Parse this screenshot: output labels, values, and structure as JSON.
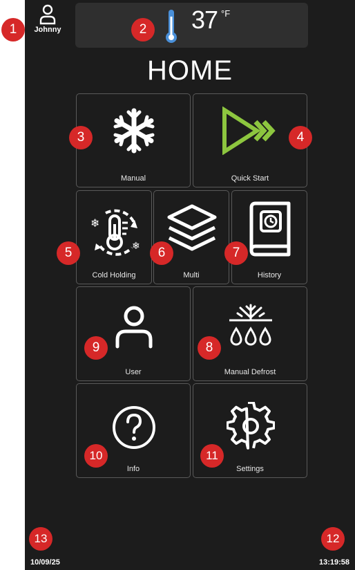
{
  "header": {
    "user_name": "Johnny",
    "temperature": "37",
    "temperature_unit": "°F"
  },
  "page_title": "HOME",
  "tiles": {
    "manual": "Manual",
    "quick_start": "Quick Start",
    "cold_holding": "Cold Holding",
    "multi": "Multi",
    "history": "History",
    "user": "User",
    "manual_defrost": "Manual Defrost",
    "info": "Info",
    "settings": "Settings"
  },
  "footer": {
    "date": "10/09/25",
    "time": "13:19:58"
  },
  "callouts": [
    "1",
    "2",
    "3",
    "4",
    "5",
    "6",
    "7",
    "8",
    "9",
    "10",
    "11",
    "12",
    "13"
  ],
  "colors": {
    "screen_bg": "#1c1c1c",
    "accent_green": "#8dc63f",
    "thermometer_blue": "#4a90d9",
    "callout_red": "#d62828"
  },
  "icons": {
    "user": "person-icon",
    "thermometer": "thermometer-icon",
    "manual": "snowflake-icon",
    "quick_start": "fast-forward-icon",
    "cold_holding": "thermometer-cycle-icon",
    "multi": "layers-icon",
    "history": "book-clock-icon",
    "user_tile": "person-icon",
    "manual_defrost": "defrost-drops-icon",
    "info": "question-icon",
    "settings": "gear-icon"
  }
}
